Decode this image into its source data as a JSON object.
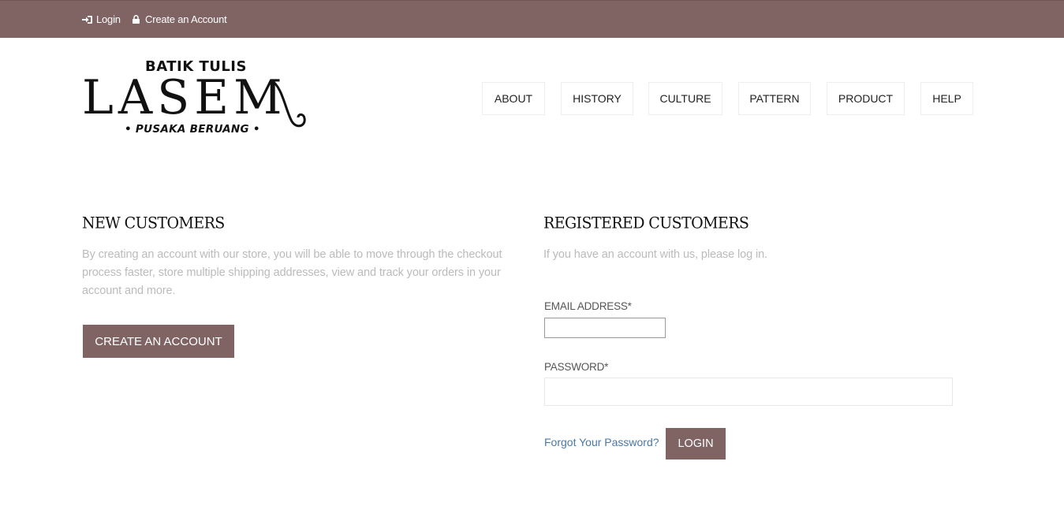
{
  "topbar": {
    "login_label": "Login",
    "create_account_label": "Create an Account",
    "login_icon": "sign-in-icon",
    "create_account_icon": "lock-icon",
    "background_color": "#806363"
  },
  "logo": {
    "line1": "BATIK TULIS",
    "line2": "LASEM",
    "line3": "• PUSAKA BERUANG •"
  },
  "nav": {
    "items": [
      {
        "label": "ABOUT"
      },
      {
        "label": "HISTORY"
      },
      {
        "label": "CULTURE"
      },
      {
        "label": "PATTERN"
      },
      {
        "label": "PRODUCT"
      },
      {
        "label": "HELP"
      }
    ]
  },
  "new_customers": {
    "title": "NEW CUSTOMERS",
    "description": "By creating an account with our store, you will be able to move through the checkout process faster, store multiple shipping addresses, view and track your orders in your account and more.",
    "button_label": "CREATE AN ACCOUNT"
  },
  "registered_customers": {
    "title": "REGISTERED CUSTOMERS",
    "description": "If you have an account with us, please log in.",
    "email_label": "EMAIL ADDRESS*",
    "email_value": "",
    "password_label": "PASSWORD*",
    "password_value": "",
    "forgot_label": "Forgot Your Password?",
    "login_button_label": "LOGIN"
  },
  "colors": {
    "accent": "#806363",
    "link": "#4a78a8",
    "muted_text": "#bbbbbb"
  }
}
